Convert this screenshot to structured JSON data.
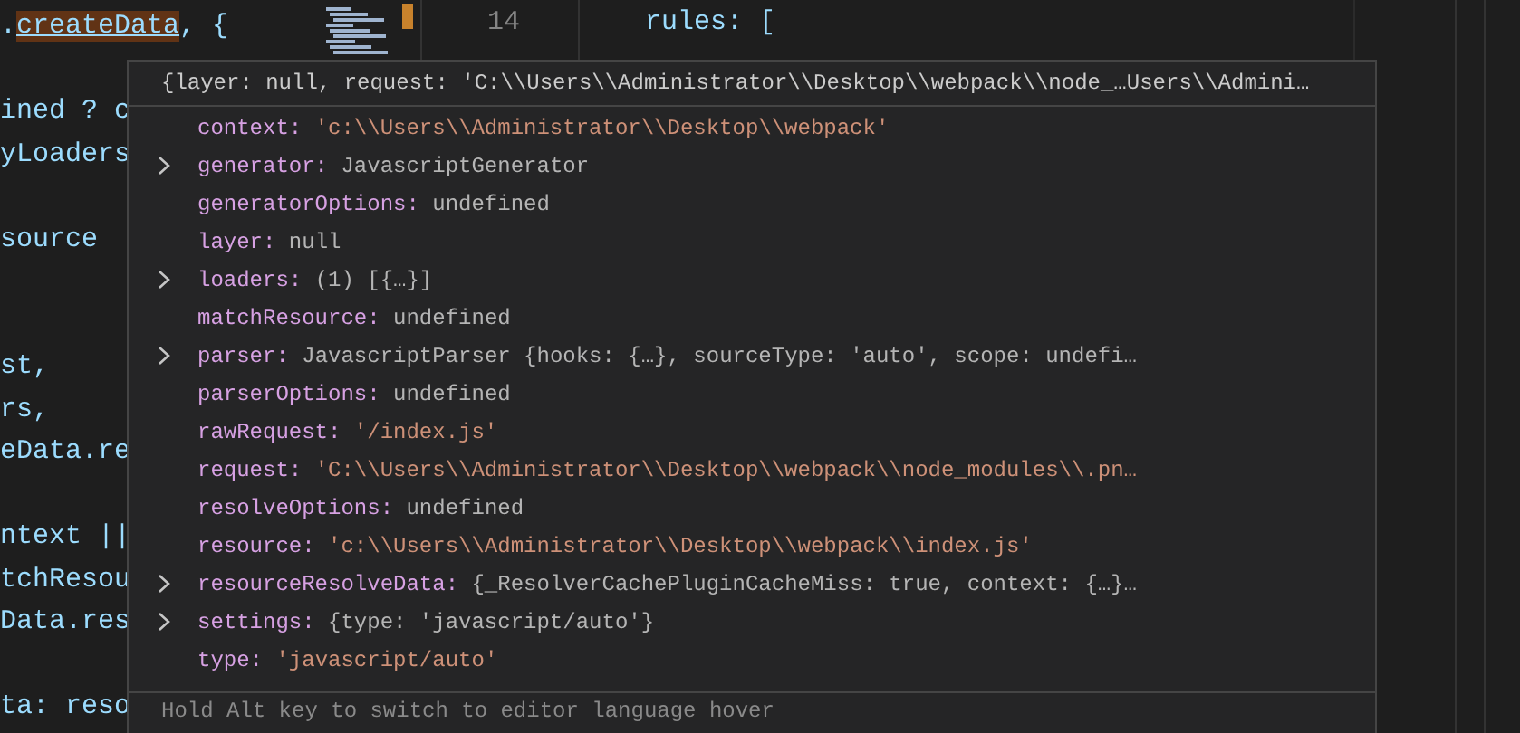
{
  "editor": {
    "highlighted_line": {
      "before": ".",
      "symbol": "createData",
      "after": ", {"
    },
    "code_blocks": [
      [
        "ined ? c",
        "yLoaders"
      ],
      [
        "source"
      ],
      [
        "st,",
        "rs,",
        "eData.re"
      ],
      [
        "ntext ||",
        "tchResou",
        "Data.res"
      ],
      [
        "ta: reso"
      ]
    ],
    "line_number": "14",
    "right_code": "rules: ["
  },
  "hover": {
    "summary": "{layer: null, request: 'C:\\\\Users\\\\Administrator\\\\Desktop\\\\webpack\\\\node_…Users\\\\Admini…",
    "properties": [
      {
        "key": "context:",
        "value": "'c:\\\\Users\\\\Administrator\\\\Desktop\\\\webpack'",
        "kind": "string",
        "expandable": false
      },
      {
        "key": "generator:",
        "value": "JavascriptGenerator",
        "kind": "plain",
        "expandable": true
      },
      {
        "key": "generatorOptions:",
        "value": "undefined",
        "kind": "plain",
        "expandable": false
      },
      {
        "key": "layer:",
        "value": "null",
        "kind": "plain",
        "expandable": false
      },
      {
        "key": "loaders:",
        "value": "(1) [{…}]",
        "kind": "plain",
        "expandable": true
      },
      {
        "key": "matchResource:",
        "value": "undefined",
        "kind": "plain",
        "expandable": false
      },
      {
        "key": "parser:",
        "value": "JavascriptParser {hooks: {…}, sourceType: 'auto', scope: undefi…",
        "kind": "plain",
        "expandable": true
      },
      {
        "key": "parserOptions:",
        "value": "undefined",
        "kind": "plain",
        "expandable": false
      },
      {
        "key": "rawRequest:",
        "value": "'/index.js'",
        "kind": "string",
        "expandable": false
      },
      {
        "key": "request:",
        "value": "'C:\\\\Users\\\\Administrator\\\\Desktop\\\\webpack\\\\node_modules\\\\.pn…",
        "kind": "string",
        "expandable": false
      },
      {
        "key": "resolveOptions:",
        "value": "undefined",
        "kind": "plain",
        "expandable": false
      },
      {
        "key": "resource:",
        "value": "'c:\\\\Users\\\\Administrator\\\\Desktop\\\\webpack\\\\index.js'",
        "kind": "string",
        "expandable": false
      },
      {
        "key": "resourceResolveData:",
        "value": "{_ResolverCachePluginCacheMiss: true, context: {…}…",
        "kind": "plain",
        "expandable": true
      },
      {
        "key": "settings:",
        "value": "{type: 'javascript/auto'}",
        "kind": "plain",
        "expandable": true
      },
      {
        "key": "type:",
        "value": "'javascript/auto'",
        "kind": "string",
        "expandable": false
      }
    ],
    "status": "Hold Alt key to switch to editor language hover"
  }
}
